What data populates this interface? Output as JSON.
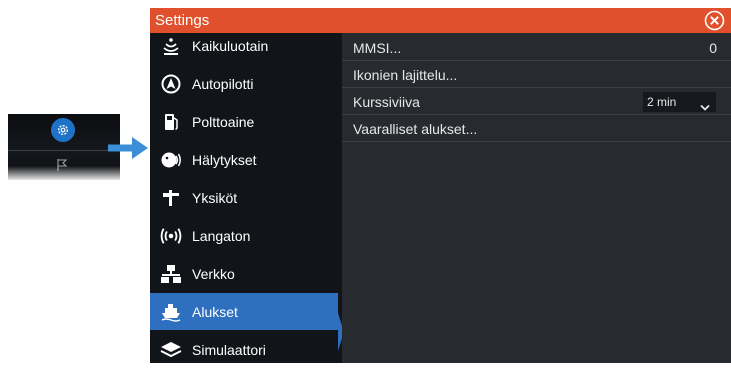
{
  "window": {
    "title": "Settings"
  },
  "sidebar": {
    "items": [
      {
        "label": "Kaikuluotain",
        "icon": "sonar-icon"
      },
      {
        "label": "Autopilotti",
        "icon": "autopilot-icon"
      },
      {
        "label": "Polttoaine",
        "icon": "fuel-pump-icon"
      },
      {
        "label": "Hälytykset",
        "icon": "alarm-icon"
      },
      {
        "label": "Yksiköt",
        "icon": "units-icon"
      },
      {
        "label": "Langaton",
        "icon": "wireless-icon"
      },
      {
        "label": "Verkko",
        "icon": "network-icon"
      },
      {
        "label": "Alukset",
        "icon": "vessels-icon",
        "active": true
      },
      {
        "label": "Simulaattori",
        "icon": "simulator-layers-icon"
      }
    ]
  },
  "main": {
    "mmsi": {
      "label": "MMSI...",
      "value": "0"
    },
    "icon_sort": {
      "label": "Ikonien lajittelu..."
    },
    "course_line": {
      "label": "Kurssiviiva",
      "selected": "2 min"
    },
    "dangerous": {
      "label": "Vaaralliset alukset..."
    }
  },
  "colors": {
    "titlebar": "#e0502c",
    "active": "#2e6fc0",
    "arrow": "#3a8fd6"
  }
}
